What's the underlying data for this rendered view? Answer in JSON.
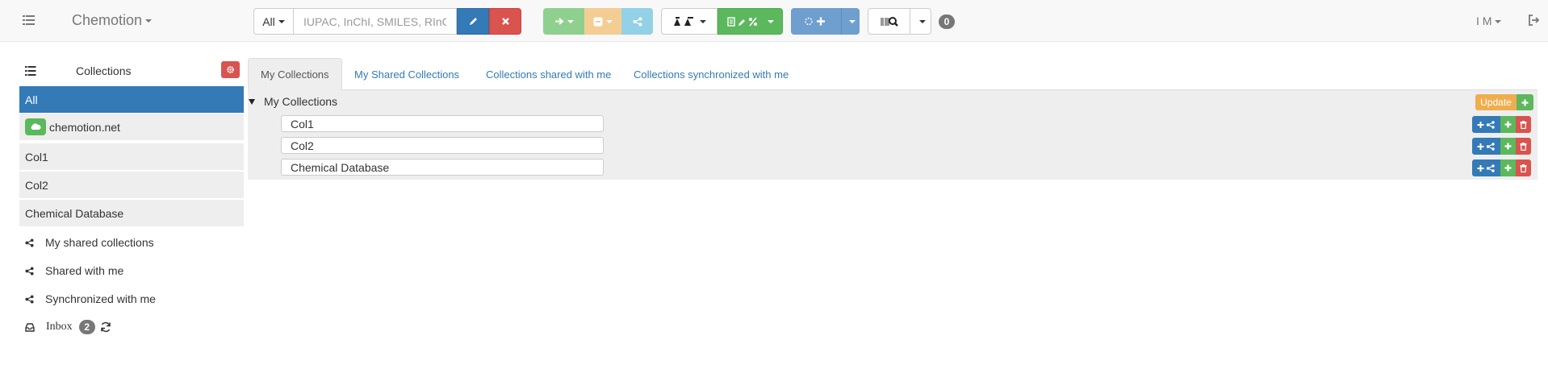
{
  "navbar": {
    "brand": "Chemotion",
    "search": {
      "scope": "All",
      "placeholder": "IUPAC, InChI, SMILES, RInChI..."
    },
    "notification_count": "0",
    "user_initials": "I M"
  },
  "sidebar": {
    "header": "Collections",
    "items": [
      {
        "label": "All",
        "active": true
      },
      {
        "label": "chemotion.net",
        "icon": "cloud-icon"
      },
      {
        "label": "Col1"
      },
      {
        "label": "Col2"
      },
      {
        "label": "Chemical Database"
      }
    ],
    "links": [
      {
        "label": "My shared collections",
        "icon": "share-icon"
      },
      {
        "label": "Shared with me",
        "icon": "share-icon"
      },
      {
        "label": "Synchronized with me",
        "icon": "share-icon"
      }
    ],
    "inbox": {
      "label": "Inbox",
      "count": "2"
    }
  },
  "main": {
    "tabs": [
      {
        "label": "My Collections",
        "active": true
      },
      {
        "label": "My Shared Collections"
      },
      {
        "label": "Collections shared with me"
      },
      {
        "label": "Collections synchronized with me"
      }
    ],
    "tree": {
      "root_label": "My Collections",
      "update_label": "Update",
      "collections": [
        "Col1",
        "Col2",
        "Chemical Database"
      ]
    }
  },
  "colors": {
    "primary": "#337ab7",
    "success": "#5cb85c",
    "danger": "#d9534f",
    "warning": "#f0ad4e",
    "badge": "#777777"
  }
}
